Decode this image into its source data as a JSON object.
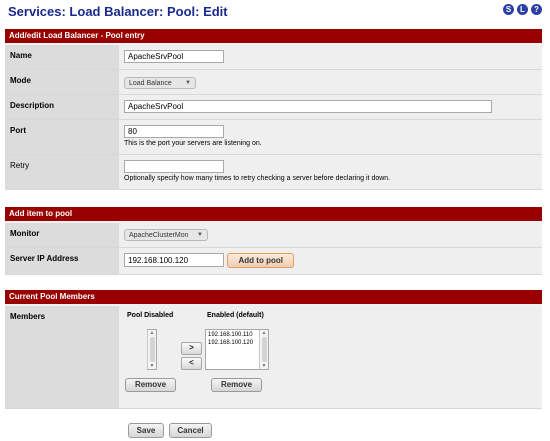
{
  "header": {
    "title": "Services: Load Balancer: Pool: Edit"
  },
  "top_icons": [
    {
      "name": "status-icon",
      "glyph": "S"
    },
    {
      "name": "log-icon",
      "glyph": "L"
    },
    {
      "name": "help-icon",
      "glyph": "?"
    }
  ],
  "pool_entry": {
    "heading": "Add/edit Load Balancer - Pool entry",
    "name": {
      "label": "Name",
      "value": "ApacheSrvPool"
    },
    "mode": {
      "label": "Mode",
      "value": "Load Balance"
    },
    "description": {
      "label": "Description",
      "value": "ApacheSrvPool"
    },
    "port": {
      "label": "Port",
      "value": "80",
      "hint": "This is the port your servers are listening on."
    },
    "retry": {
      "label": "Retry",
      "value": "",
      "hint": "Optionally specify how many times to retry checking a server before declaring it down."
    }
  },
  "add_item": {
    "heading": "Add item to pool",
    "monitor": {
      "label": "Monitor",
      "value": "ApacheClusterMon"
    },
    "server_ip": {
      "label": "Server IP Address",
      "value": "192.168.100.120",
      "button": "Add to pool"
    }
  },
  "members": {
    "heading": "Current Pool Members",
    "label": "Members",
    "disabled_title": "Pool Disabled",
    "enabled_title": "Enabled (default)",
    "disabled_items": [],
    "enabled_items": [
      "192.168.100.110",
      "192.168.100.120"
    ],
    "move_right": ">",
    "move_left": "<",
    "remove_label": "Remove"
  },
  "footer": {
    "save": "Save",
    "cancel": "Cancel"
  },
  "colors": {
    "section_header": "#990000",
    "title": "#1a2a8c",
    "label_bg": "#dcdcdc",
    "value_bg": "#efefef"
  }
}
